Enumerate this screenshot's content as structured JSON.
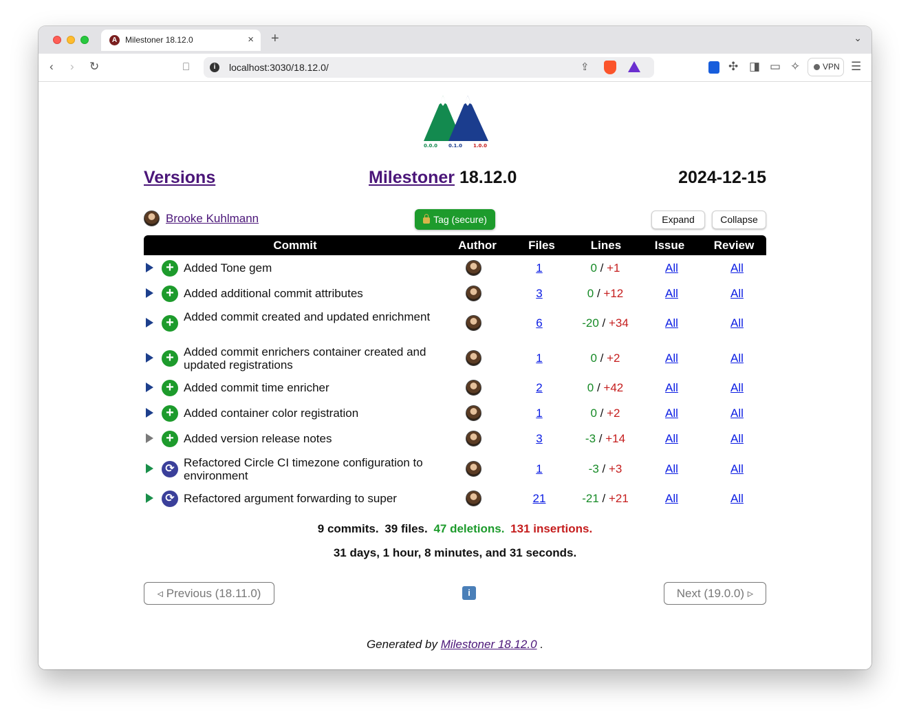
{
  "browser": {
    "tab_title": "Milestoner 18.12.0",
    "tab_favicon": "A",
    "url": "localhost:3030/18.12.0/",
    "vpn_label": "VPN",
    "icons": [
      "back-icon",
      "forward-icon",
      "reload-icon",
      "bookmark-icon",
      "share-icon",
      "brave-shields-icon",
      "brave-rewards-icon",
      "bitwarden-icon",
      "extensions-icon",
      "sidebar-icon",
      "wallet-icon",
      "leo-ai-icon",
      "menu-icon"
    ]
  },
  "page": {
    "logo_labels": [
      "0.0.0",
      "0.1.0",
      "1.0.0"
    ],
    "versions_link": "Versions",
    "title_link": "Milestoner",
    "version": "18.12.0",
    "date": "2024-12-15",
    "author_name": "Brooke Kuhlmann",
    "tag_button": "Tag (secure)",
    "expand_button": "Expand",
    "collapse_button": "Collapse"
  },
  "table": {
    "headers": {
      "commit": "Commit",
      "author": "Author",
      "files": "Files",
      "lines": "Lines",
      "issue": "Issue",
      "review": "Review"
    },
    "rows": [
      {
        "kind": "added",
        "message": "Added Tone gem",
        "files": "1",
        "deletions": "0",
        "insertions": "+1",
        "issue": "All",
        "review": "All"
      },
      {
        "kind": "added",
        "message": "Added additional commit attributes",
        "files": "3",
        "deletions": "0",
        "insertions": "+12",
        "issue": "All",
        "review": "All"
      },
      {
        "kind": "added",
        "message": "Added commit created and updated enrichment",
        "files": "6",
        "deletions": "-20",
        "insertions": "+34",
        "issue": "All",
        "review": "All"
      },
      {
        "kind": "added",
        "message": "Added commit enrichers container created and updated registrations",
        "files": "1",
        "deletions": "0",
        "insertions": "+2",
        "issue": "All",
        "review": "All"
      },
      {
        "kind": "added",
        "message": "Added commit time enricher",
        "files": "2",
        "deletions": "0",
        "insertions": "+42",
        "issue": "All",
        "review": "All"
      },
      {
        "kind": "added",
        "message": "Added container color registration",
        "files": "1",
        "deletions": "0",
        "insertions": "+2",
        "issue": "All",
        "review": "All"
      },
      {
        "kind": "added",
        "message": "Added version release notes",
        "files": "3",
        "deletions": "-3",
        "insertions": "+14",
        "issue": "All",
        "review": "All"
      },
      {
        "kind": "refactored",
        "message": "Refactored Circle CI timezone configuration to environment",
        "files": "1",
        "deletions": "-3",
        "insertions": "+3",
        "issue": "All",
        "review": "All"
      },
      {
        "kind": "refactored",
        "message": "Refactored argument forwarding to super",
        "files": "21",
        "deletions": "-21",
        "insertions": "+21",
        "issue": "All",
        "review": "All"
      }
    ],
    "colors": {
      "added": "#1d9b2c",
      "refactored": "#3a3f9a",
      "deletion": "#168a26",
      "insertion": "#c51d1d",
      "link": "#0a1ce3",
      "visited": "#4b1679"
    }
  },
  "summary": {
    "commits": "9 commits.",
    "files": "39 files.",
    "deletions": "47 deletions.",
    "insertions": "131 insertions.",
    "duration": "31 days, 1 hour, 8 minutes, and 31 seconds."
  },
  "navigation": {
    "previous": "◃ Previous (18.11.0)",
    "next": "Next (19.0.0) ▹",
    "info": "i"
  },
  "footer": {
    "prefix": "Generated by",
    "link": "Milestoner 18.12.0",
    "suffix": "."
  }
}
